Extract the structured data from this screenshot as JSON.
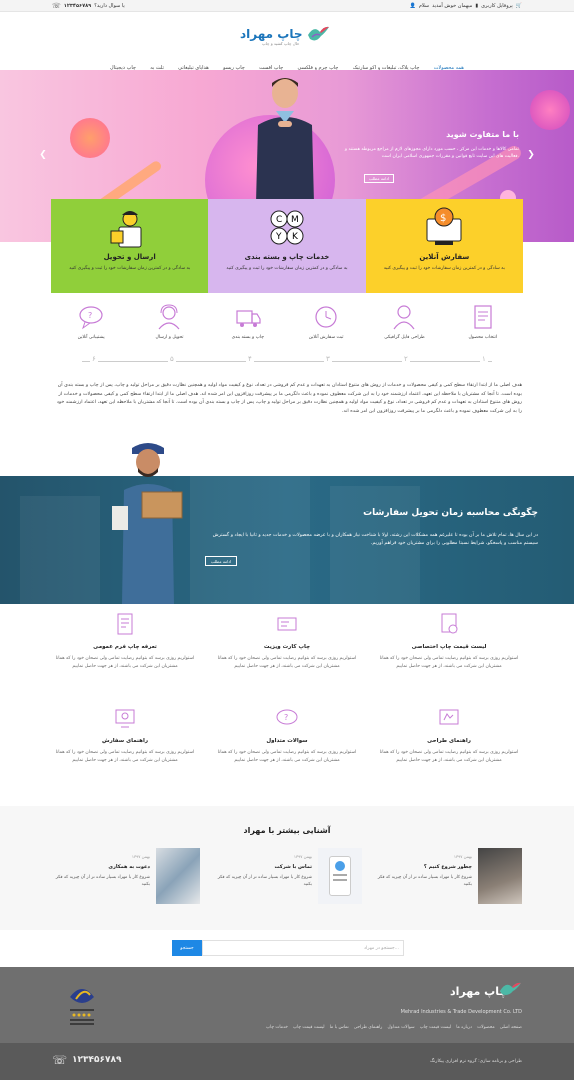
{
  "topbar": {
    "phone": "۱۲۳۴۵۶۷۸۹",
    "question": "یا سوال دارید؟",
    "greeting": "سلام",
    "welcome": "میهمان خوش آمدید",
    "profile": "پروفایل کاربری"
  },
  "logo": {
    "text": "چاپ مهراد",
    "tagline": "حال چاپ کشید و چاپ"
  },
  "nav": [
    "همه محصولات",
    "چاپ پلاک، تبلیغات و اکو سارتیک",
    "چاپ چرم و فلکسی",
    "چاپ افست",
    "چاپ ریسو",
    "هدایای تبلیغاتی",
    "ثلث به",
    "چاپ دیجیتال"
  ],
  "hero": {
    "title": "با ما متفاوت شوید",
    "text": "تمامی کالاها و خدمات این مرکز ، حسب مورد دارای مجوزهای لازم از مراجع مربوطه هستند و فعالیت های این سایت تابع قوانین و مقررات جمهوری اسلامی ایران است.",
    "button": "ادامه مطلب",
    "prev": "❮",
    "next": "❯"
  },
  "boxes": [
    {
      "title": "سفارش آنلاین",
      "desc": "به سادگی و در کمترین زمان سفارشات خود را ثبت و پیگیری کنید",
      "color": "#fcd02a"
    },
    {
      "title": "خدمات چاپ و بسته بندی",
      "desc": "به سادگی و در کمترین زمان سفارشات خود را ثبت و پیگیری کنید",
      "color": "#d7b6ee"
    },
    {
      "title": "ارسال و تحویل",
      "desc": "به سادگی و در کمترین زمان سفارشات خود را ثبت و پیگیری کنید",
      "color": "#90cf3a"
    }
  ],
  "steps": [
    {
      "label": "انتخاب محصول",
      "num": "۱"
    },
    {
      "label": "طراحی فایل گرافیکی",
      "num": "۲"
    },
    {
      "label": "ثبت سفارش آنلاین",
      "num": "۳"
    },
    {
      "label": "چاپ و بسته بندی",
      "num": "۴"
    },
    {
      "label": "تحویل و ارسال",
      "num": "۵"
    },
    {
      "label": "پشتیبانی آنلاین",
      "num": "۶"
    }
  ],
  "about": "هدف اصلی ما از ابتدا ارتقاء سطح کمی و کیفی محصولات و خدمات از روش های متنوع استادان به تعهدات و عدم کم فروشی در تعداد، نوع و کیفیت مواد اولیه و همچنین نظارت دقیق بر مراحل تولید و چاپ، پس از چاپ و بسته بندی آن بوده است. تا آنجا که مشتریان با ملاحظه این تعهد، اعتماد ارزشمند خود را به این شرکت معطوف نموده و باعث دلگرمی ما بر پیشرفت روزافزون این امر شده اند. هدف اصلی ما از ابتدا ارتقاء سطح کمی و کیفی محصولات و خدمات از روش های متنوع استادان به تعهدات و عدم کم فروشی در تعداد، نوع و کیفیت مواد اولیه و همچنین نظارت دقیق بر مراحل تولید و چاپ، پس از چاپ و بسته بندی آن بوده است. تا آنجا که مشتریان با ملاحظه این تعهد، اعتماد ارزشمند خود را به این شرکت معطوف نموده و باعث دلگرمی ما بر پیشرفت روزافزون این امر شده اند.",
  "delivery": {
    "title": "چگونگی محاسبه زمان تحویل سفارشات",
    "text": "در این سال ها، تمام تلاش ما بر آن بوده تا علیرغم همه مشکلات این رشته، اولا با شناخت نیاز همکاران و با عرضه محصولات و خدمات جدید و ثانیا با ایجاد و گسترش سیستم مناسب و پاسخگو، شرایط نسبتا مطلوبی را برای مشتریان خود فراهم آوریم.",
    "button": "ادامه مطلب"
  },
  "faqs": [
    {
      "title": "لیست قیمت چاپ اختصاصی",
      "desc": "استولریم روزی برسد که بتوانیم رضایت تمامی ولی نصحان خود را که همانا مشتریان این شرکت می باشند، از هر جهت حاصل نماییم"
    },
    {
      "title": "چاپ کارت ویزیت",
      "desc": "استولریم روزی برسد که بتوانیم رضایت تمامی ولی نصحان خود را که همانا مشتریان این شرکت می باشند، از هر جهت حاصل نماییم"
    },
    {
      "title": "تعرفه چاپ فرم عمومی",
      "desc": "استولریم روزی برسد که بتوانیم رضایت تمامی ولی نصحان خود را که همانا مشتریان این شرکت می باشند، از هر جهت حاصل نماییم"
    },
    {
      "title": "راهنمای طراحی",
      "desc": "استولریم روزی برسد که بتوانیم رضایت تمامی ولی نصحان خود را که همانا مشتریان این شرکت می باشند، از هر جهت حاصل نماییم"
    },
    {
      "title": "سوالات متداول",
      "desc": "استولریم روزی برسد که بتوانیم رضایت تمامی ولی نصحان خود را که همانا مشتریان این شرکت می باشند، از هر جهت حاصل نماییم"
    },
    {
      "title": "راهنمای سفارش",
      "desc": "استولریم روزی برسد که بتوانیم رضایت تمامی ولی نصحان خود را که همانا مشتریان این شرکت می باشند، از هر جهت حاصل نماییم"
    }
  ],
  "learn": {
    "title": "آشنایی بیشتر با مهراد",
    "posts": [
      {
        "date": "بهمن ۱۳۹۷",
        "title": "چطور شروع کنیم ؟",
        "desc": "شروع کار با مهراد بسیار ساده تر از آن چیزیه که فکر بکنید"
      },
      {
        "date": "بهمن ۱۳۹۷",
        "title": "تماس با شرکت",
        "desc": "شروع کار با مهراد بسیار ساده تر از آن چیزیه که فکر بکنید"
      },
      {
        "date": "بهمن ۱۳۹۷",
        "title": "دعوت به همکاری",
        "desc": "شروع کار با مهراد بسیار ساده تر از آن چیزیه که فکر بکنید"
      }
    ]
  },
  "search": {
    "placeholder": "جستجو در مهراد...",
    "button": "جستجو"
  },
  "footer": {
    "company": "Mehrad Industries & Trade Development Co. LTD",
    "links": [
      "صفحه اصلی",
      "محصولات",
      "درباره ما",
      "لیست قیمت چاپ",
      "سوالات متداول",
      "راهنمای طراحی",
      "تماس با ما",
      "لیست قیمت چاپ",
      "خدمات چاپ"
    ],
    "copyright": "طراحی و برنامه سازی: گروه نرم افزاری پیکارنگ",
    "phone": "۱۲۳۴۵۶۷۸۹"
  }
}
